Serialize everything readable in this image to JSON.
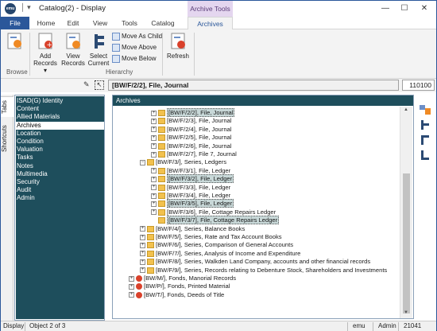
{
  "window": {
    "title": "Catalog(2) - Display",
    "app_icon": "emu",
    "minimize": "—",
    "maximize": "☐",
    "close": "✕"
  },
  "context_tab_header": "Archive Tools",
  "tabs": [
    {
      "label": "File"
    },
    {
      "label": "Home"
    },
    {
      "label": "Edit"
    },
    {
      "label": "View"
    },
    {
      "label": "Tools"
    },
    {
      "label": "Catalog"
    },
    {
      "label": "Archives"
    }
  ],
  "ribbon": {
    "browse": {
      "label": "Browse"
    },
    "add_records": {
      "line1": "Add",
      "line2": "Records ▾"
    },
    "view_records": {
      "line1": "View",
      "line2": "Records"
    },
    "select_current": {
      "line1": "Select",
      "line2": "Current"
    },
    "move_as_child": "Move As Child",
    "move_above": "Move Above",
    "move_below": "Move Below",
    "hierarchy": "Hierarchy",
    "refresh": "Refresh"
  },
  "address": {
    "value": "[BW/F/2/2], File, Journal",
    "count": "110100"
  },
  "side_tabs": {
    "tabs": "Tabs",
    "shortcuts": "Shortcuts"
  },
  "left_list": [
    "ISAD(G) Identity",
    "Content",
    "Allied Materials",
    "Archives",
    "Location",
    "Condition",
    "Valuation",
    "Tasks",
    "Notes",
    "Multimedia",
    "Security",
    "Audit",
    "Admin"
  ],
  "left_selected": "Archives",
  "main_header": "Archives",
  "tree": [
    {
      "text": "[BW/F/2/2], File, Journal",
      "icon": "folder",
      "hl": true
    },
    {
      "text": "[BW/F/2/3], File, Journal",
      "icon": "folder",
      "hl": false
    },
    {
      "text": "[BW/F/2/4], File, Journal",
      "icon": "folder",
      "hl": false
    },
    {
      "text": "[BW/F/2/5], File, Journal",
      "icon": "folder",
      "hl": false
    },
    {
      "text": "[BW/F/2/6], File, Journal",
      "icon": "folder",
      "hl": false
    },
    {
      "text": "[BW/F/2/7], File 7, Journal",
      "icon": "folder",
      "hl": false
    },
    {
      "text": "[BW/F/3/], Series, Ledgers",
      "icon": "folder",
      "hl": false
    },
    {
      "text": "[BW/F/3/1], File, Ledger",
      "icon": "folder",
      "hl": false
    },
    {
      "text": "[BW/F/3/2], File, Ledger",
      "icon": "folder",
      "hl": true
    },
    {
      "text": "[BW/F/3/3], File, Ledger",
      "icon": "folder",
      "hl": false
    },
    {
      "text": "[BW/F/3/4], File, Ledger",
      "icon": "folder",
      "hl": false
    },
    {
      "text": "[BW/F/3/5], File, Ledger",
      "icon": "folder",
      "hl": true
    },
    {
      "text": "[BW/F/3/6], File, Cottage Repairs Ledger",
      "icon": "folder",
      "hl": false
    },
    {
      "text": "[BW/F/3/7], File, Cottage Repairs Ledger",
      "icon": "folder",
      "hl": true
    },
    {
      "text": "[BW/F/4/], Series, Balance Books",
      "icon": "folder",
      "hl": false
    },
    {
      "text": "[BW/F/5/], Series, Rate and Tax Account Books",
      "icon": "folder",
      "hl": false
    },
    {
      "text": "[BW/F/6/], Series, Comparison of General Accounts",
      "icon": "folder",
      "hl": false
    },
    {
      "text": "[BW/F/7/], Series, Analysis of Income and Expenditure",
      "icon": "folder",
      "hl": false
    },
    {
      "text": "[BW/F/8/], Series, Walkden Land Company, accounts and other financial records",
      "icon": "folder",
      "hl": false
    },
    {
      "text": "[BW/F/9/], Series, Records relating to Debenture Stock, Shareholders and Investments",
      "icon": "folder",
      "hl": false
    },
    {
      "text": "[BW/M/], Fonds, Manorial Records",
      "icon": "fonds",
      "hl": false
    },
    {
      "text": "[BW/P/], Fonds, Printed Material",
      "icon": "fonds",
      "hl": false
    },
    {
      "text": "[BW/T/], Fonds, Deeds of Title",
      "icon": "fonds",
      "hl": false
    }
  ],
  "status": {
    "mode": "Display",
    "position": "Object 2 of 3",
    "user": "emu",
    "role": "Admin",
    "number": "21041"
  },
  "colors": {
    "accent": "#2b579a",
    "panel": "#1e4e5c",
    "context": "#e4d6ef"
  }
}
